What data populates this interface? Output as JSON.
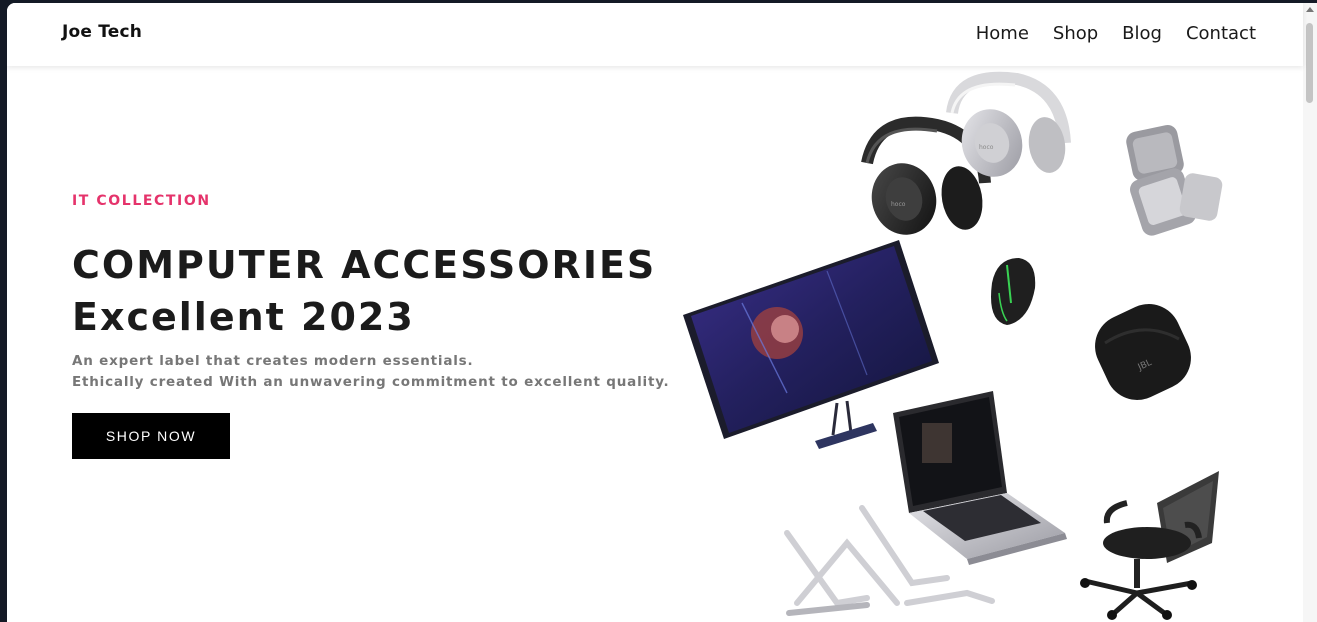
{
  "header": {
    "logo": "Joe Tech",
    "nav": [
      "Home",
      "Shop",
      "Blog",
      "Contact"
    ]
  },
  "hero": {
    "eyebrow": "IT COLLECTION",
    "headline_line1": "COMPUTER ACCESSORIES",
    "headline_line2": "Excellent 2023",
    "description_line1": "An expert label that creates modern essentials.",
    "description_line2": "Ethically created With an unwavering commitment to excellent quality.",
    "cta_label": "SHOP NOW"
  },
  "colors": {
    "accent": "#e5336b",
    "button": "#000000",
    "text": "#1b1b1b",
    "muted": "#777777"
  },
  "products": [
    {
      "name": "black-headphones-icon"
    },
    {
      "name": "white-headphones-icon"
    },
    {
      "name": "storage-case-icon"
    },
    {
      "name": "gaming-mouse-icon"
    },
    {
      "name": "monitor-icon"
    },
    {
      "name": "earbuds-case-icon"
    },
    {
      "name": "laptop-icon"
    },
    {
      "name": "laptop-stand-icon"
    },
    {
      "name": "office-chair-icon"
    }
  ]
}
